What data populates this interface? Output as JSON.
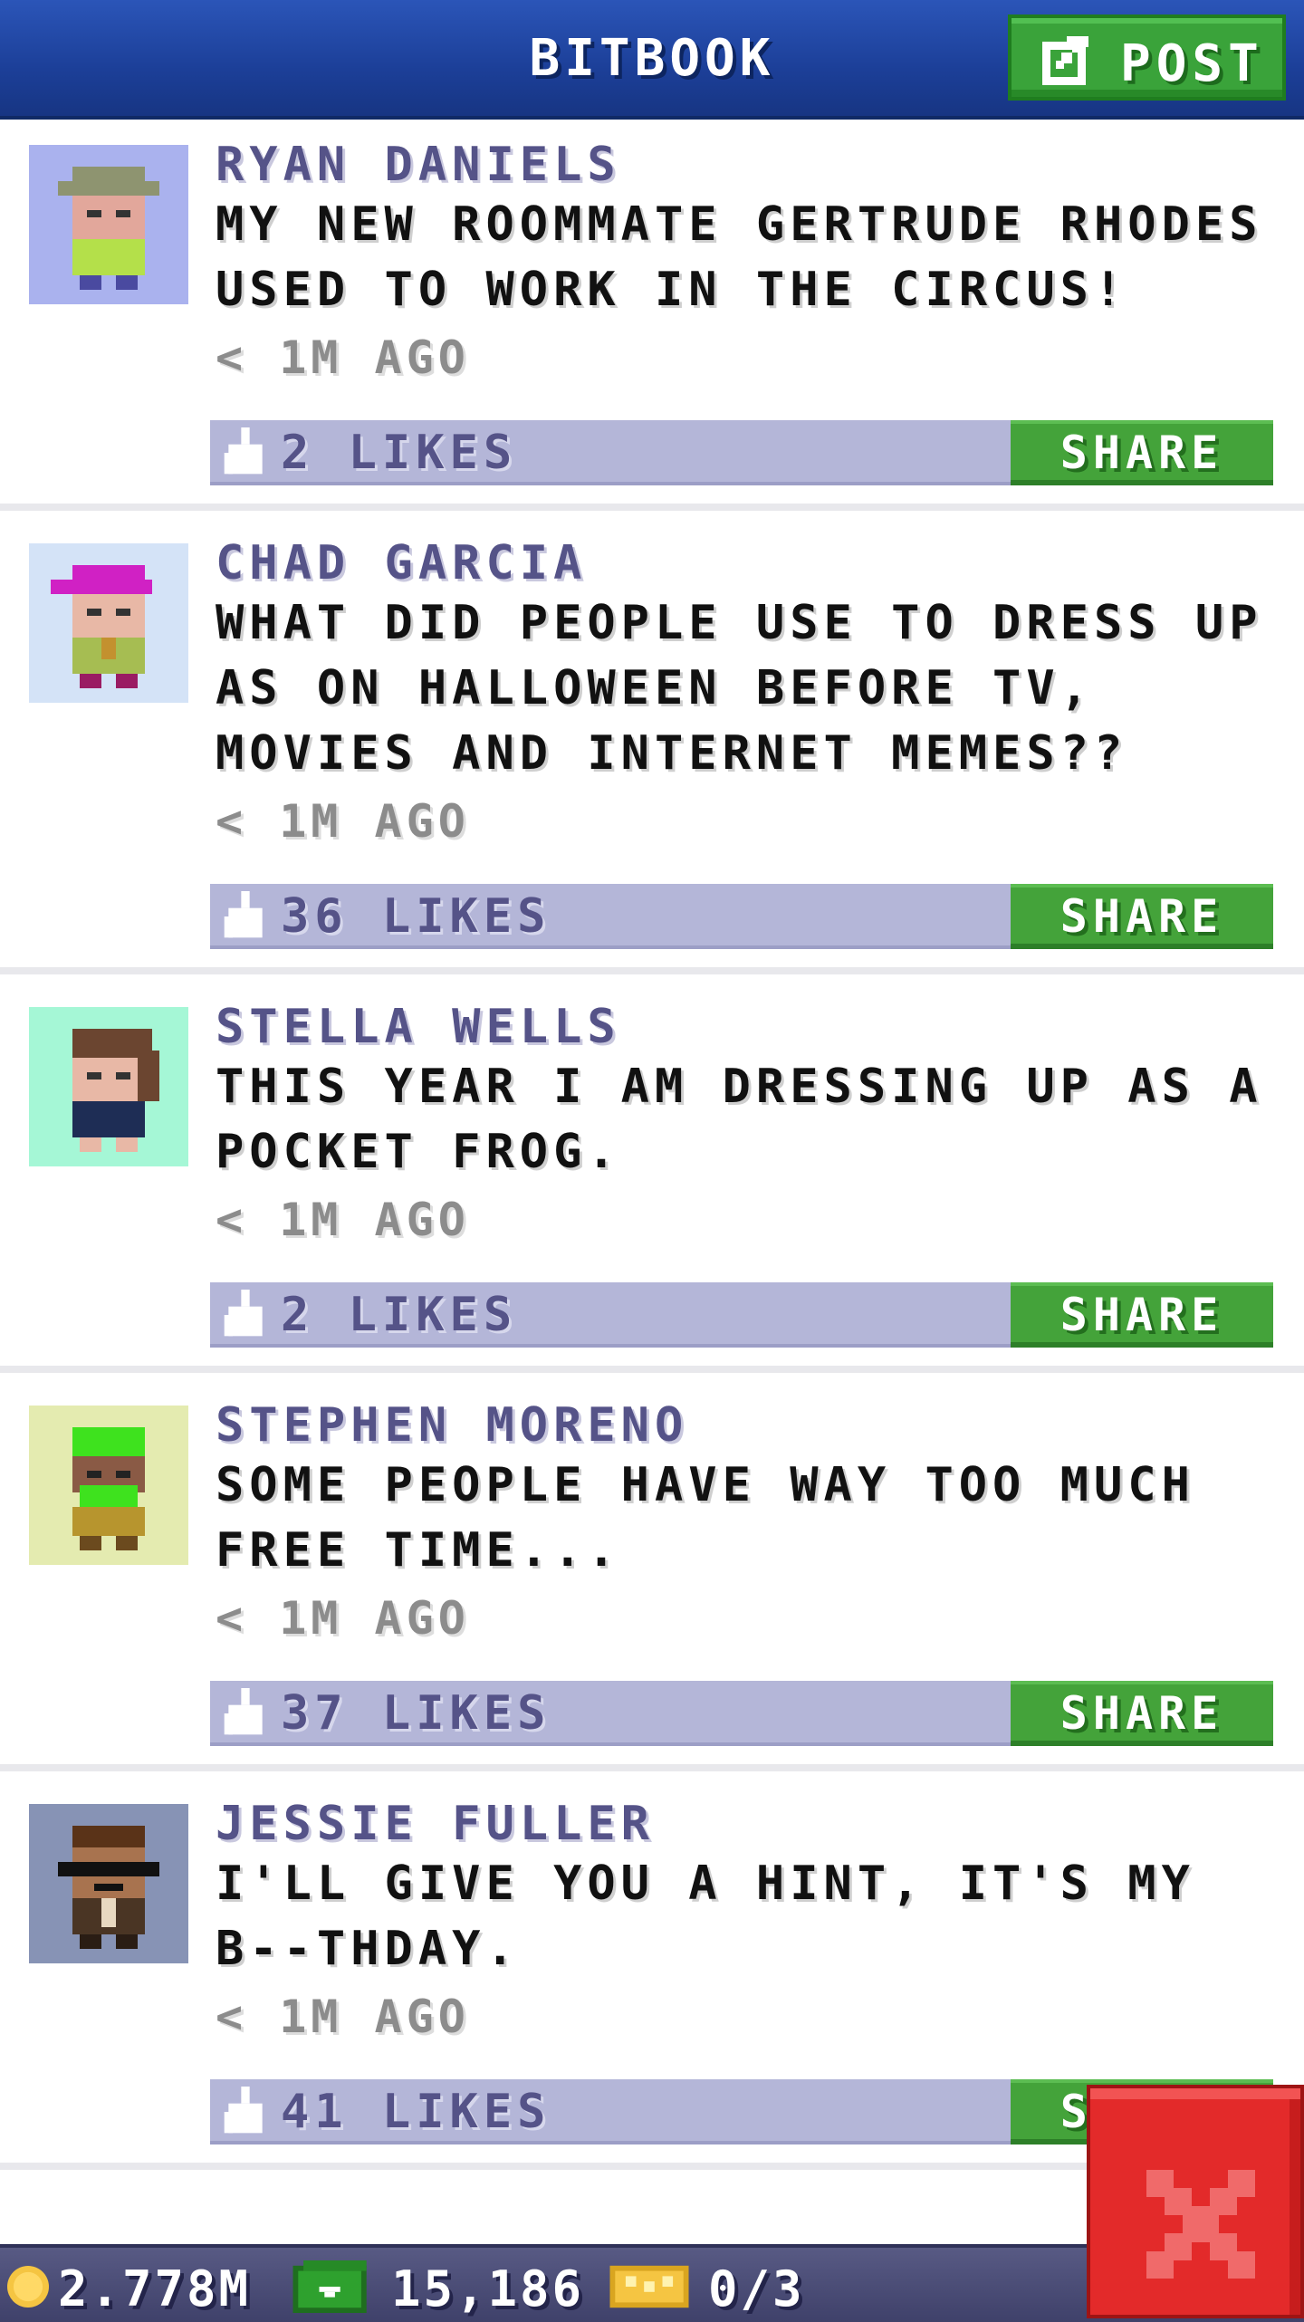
{
  "header": {
    "title": "BITBOOK",
    "post_label": "POST"
  },
  "posts": [
    {
      "author": "RYAN DANIELS",
      "message": "MY NEW ROOMMATE GERTRUDE RHODES USED TO WORK IN THE CIRCUS!",
      "time": "< 1M AGO",
      "likes": "2 LIKES",
      "share_label": "SHARE",
      "avatar_bg": "#aab2ee"
    },
    {
      "author": "CHAD GARCIA",
      "message": "WHAT DID PEOPLE USE TO DRESS UP AS ON HALLOWEEN BEFORE TV, MOVIES AND INTERNET MEMES??",
      "time": "< 1M AGO",
      "likes": "36 LIKES",
      "share_label": "SHARE",
      "avatar_bg": "#d4e3f7"
    },
    {
      "author": "STELLA WELLS",
      "message": "THIS YEAR I AM DRESSING UP AS A POCKET FROG.",
      "time": "< 1M AGO",
      "likes": "2 LIKES",
      "share_label": "SHARE",
      "avatar_bg": "#a5f7d6"
    },
    {
      "author": "STEPHEN MORENO",
      "message": "SOME PEOPLE HAVE WAY TOO MUCH FREE TIME...",
      "time": "< 1M AGO",
      "likes": "37 LIKES",
      "share_label": "SHARE",
      "avatar_bg": "#e4ebb0"
    },
    {
      "author": "JESSIE FULLER",
      "message": "I'LL GIVE YOU A HINT, IT'S MY B--THDAY.",
      "time": "< 1M AGO",
      "likes": "41 LIKES",
      "share_label": "SHARE",
      "avatar_bg": "#8793b5"
    }
  ],
  "status_bar": {
    "coins": "2.778M",
    "bux": "15,186",
    "tickets": "0/3"
  },
  "colors": {
    "header_blue": "#1c3f98",
    "share_green": "#44a33a",
    "likes_bar": "#b4b6d8",
    "author_purple": "#555388",
    "close_red": "#e32a2a"
  },
  "icons": [
    "post-edit-icon",
    "thumbs-up-icon",
    "coin-icon",
    "bux-icon",
    "ticket-icon",
    "close-x-icon"
  ]
}
